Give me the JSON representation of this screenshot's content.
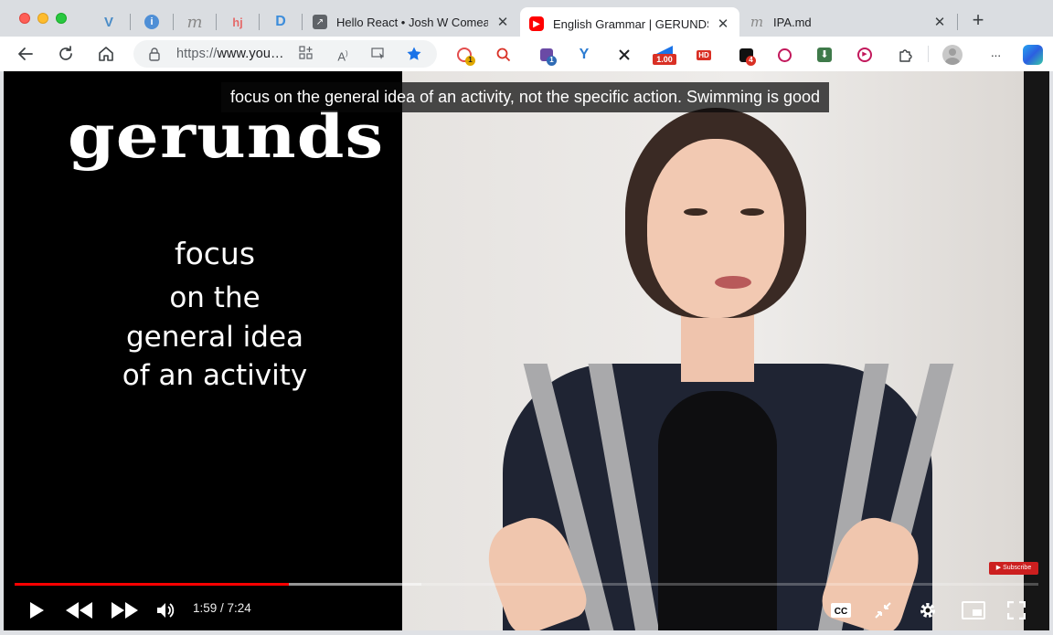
{
  "browser": {
    "tabs": [
      {
        "title": "Hello React • Josh W Comeau",
        "icon": "arrow-square-icon",
        "active": false
      },
      {
        "title": "English Grammar | GERUNDS in",
        "icon": "youtube-icon",
        "active": true
      },
      {
        "title": "IPA.md",
        "icon": "m-icon",
        "active": false
      }
    ],
    "pinned": [
      {
        "icon": "vuetify-icon",
        "glyph": "V"
      },
      {
        "icon": "info-icon",
        "glyph": "i"
      },
      {
        "icon": "m-icon",
        "glyph": "m"
      },
      {
        "icon": "hj-icon",
        "glyph": "hj"
      },
      {
        "icon": "d-icon",
        "glyph": "D"
      }
    ],
    "close_glyph": "✕",
    "new_tab_glyph": "+",
    "address": {
      "scheme": "https://",
      "host": "www.you…"
    },
    "extensions": {
      "badge_1": "1",
      "badge_1b": "1",
      "badge_rate": "1.00",
      "hd": "HD",
      "badge_4": "4"
    },
    "menu_glyph": "···"
  },
  "video": {
    "slide": {
      "heading": "gerunds",
      "line1": "focus",
      "line2": "on the",
      "line3": "general idea",
      "line4": "of an activity"
    },
    "caption": "focus on the general idea of an activity, not the specific action. Swimming is good",
    "subscribe": "Subscribe",
    "time": "1:59 / 7:24",
    "progress_played": 0.268,
    "progress_buffered": 0.397
  },
  "colors": {
    "accent": "#1a73e8",
    "youtube_red": "#ff0000"
  }
}
